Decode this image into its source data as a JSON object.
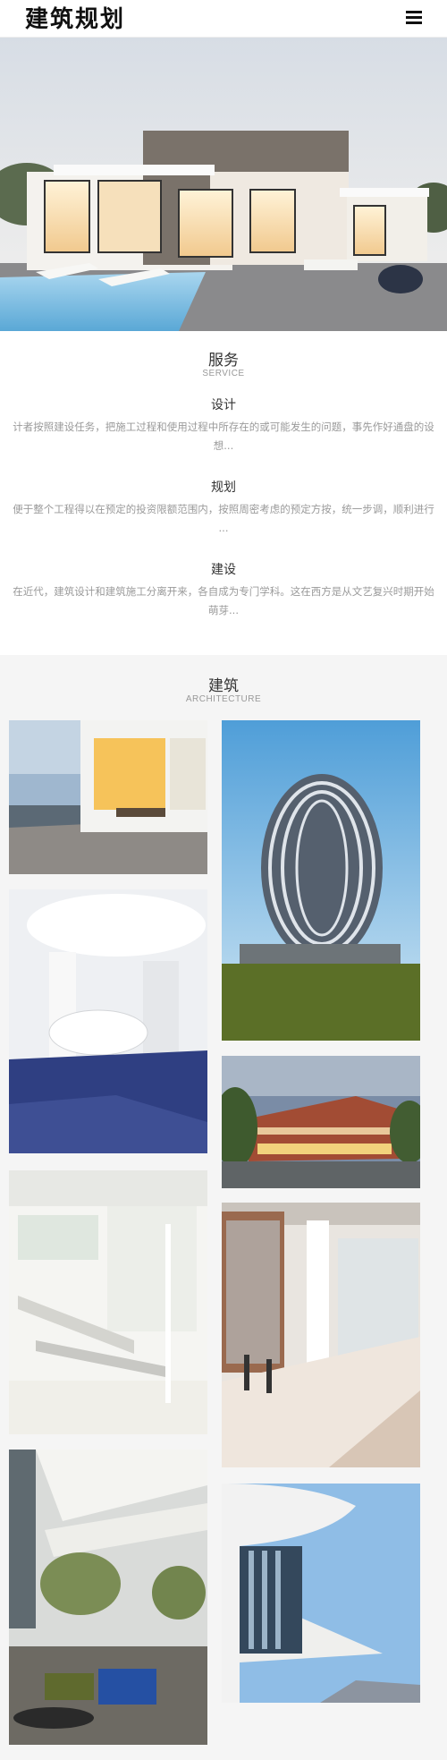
{
  "header": {
    "logo": "建筑规划",
    "menu_icon": "hamburger-menu-icon"
  },
  "hero": {
    "image": "modern-house-with-pool-photo"
  },
  "service": {
    "title": "服务",
    "subtitle": "SERVICE",
    "items": [
      {
        "title": "设计",
        "desc": "计者按照建设任务，把施工过程和使用过程中所存在的或可能发生的问题，事先作好通盘的设想..."
      },
      {
        "title": "规划",
        "desc": "便于整个工程得以在预定的投资限额范围内，按照周密考虑的预定方按，统一步调，顺利进行 ..."
      },
      {
        "title": "建设",
        "desc": "在近代，建筑设计和建筑施工分离开来，各自成为专门学科。这在西方是从文艺复兴时期开始萌芽..."
      }
    ]
  },
  "architecture": {
    "title": "建筑",
    "subtitle": "ARCHITECTURE",
    "tiles": [
      {
        "image": "glass-house-interior-photo"
      },
      {
        "image": "egg-shaped-tower-photo"
      },
      {
        "image": "white-futuristic-interior-photo"
      },
      {
        "image": "brick-commercial-building-photo"
      },
      {
        "image": "white-atrium-staircase-photo"
      },
      {
        "image": "glass-lobby-corridor-photo"
      },
      {
        "image": "atrium-lounge-with-trees-photo"
      },
      {
        "image": "curved-white-building-photo"
      }
    ]
  }
}
